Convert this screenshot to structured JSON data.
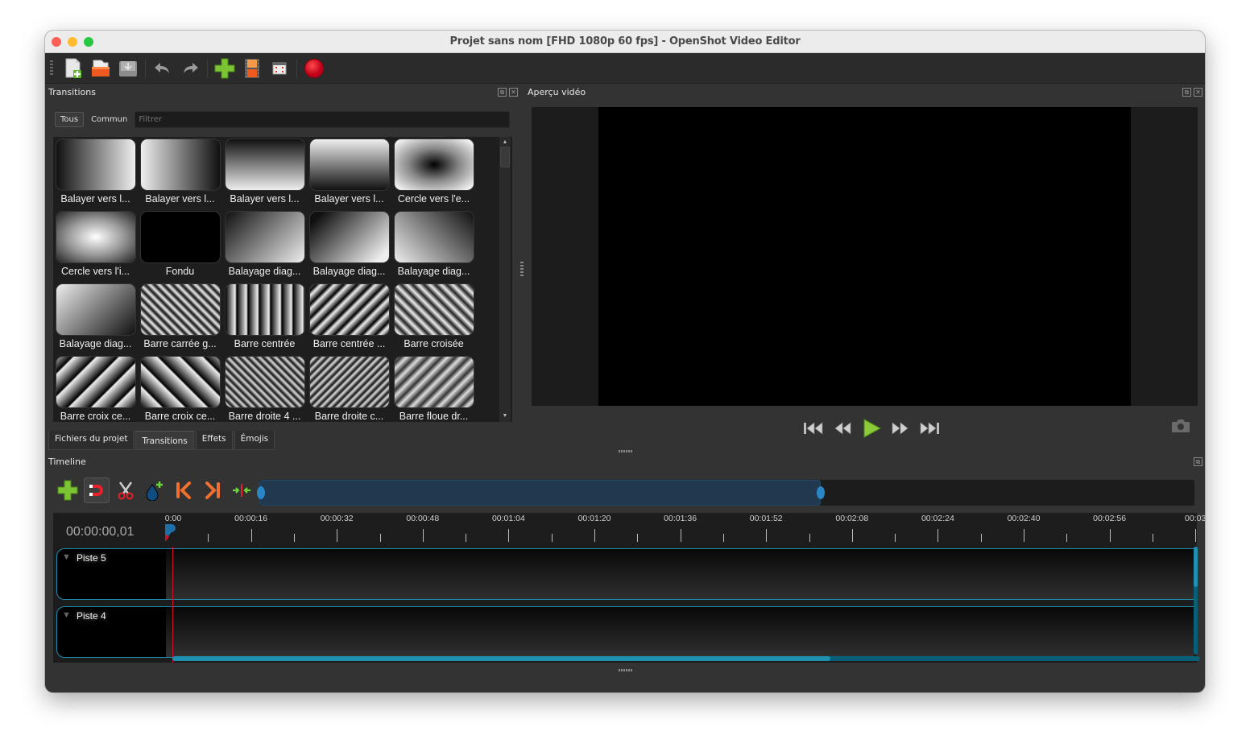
{
  "window": {
    "title": "Projet sans nom [FHD 1080p 60 fps] - OpenShot Video Editor"
  },
  "toolbar": {
    "items": [
      {
        "name": "new-project",
        "icon": "new-file-icon"
      },
      {
        "name": "open-project",
        "icon": "open-folder-icon"
      },
      {
        "name": "save-project",
        "icon": "save-icon"
      },
      {
        "name": "undo",
        "icon": "undo-icon"
      },
      {
        "name": "redo",
        "icon": "redo-icon"
      },
      {
        "name": "import-files",
        "icon": "plus-icon"
      },
      {
        "name": "choose-profile",
        "icon": "film-strip-icon"
      },
      {
        "name": "fullscreen",
        "icon": "fullscreen-icon"
      },
      {
        "name": "export-video",
        "icon": "record-icon"
      }
    ]
  },
  "transitions_panel": {
    "title": "Transitions",
    "filter_tabs": [
      "Tous",
      "Commun"
    ],
    "active_filter": "Tous",
    "filter_placeholder": "Filtrer",
    "filter_value": "",
    "items": [
      {
        "label": "Balayer vers l...",
        "thumb": "wipe-left"
      },
      {
        "label": "Balayer vers l...",
        "thumb": "wipe-right"
      },
      {
        "label": "Balayer vers l...",
        "thumb": "wipe-down"
      },
      {
        "label": "Balayer vers l...",
        "thumb": "wipe-up"
      },
      {
        "label": "Cercle vers l'e...",
        "thumb": "circle-out"
      },
      {
        "label": "Cercle vers l'i...",
        "thumb": "circle-in"
      },
      {
        "label": "Fondu",
        "thumb": "fade"
      },
      {
        "label": "Balayage diag...",
        "thumb": "diag-1"
      },
      {
        "label": "Balayage diag...",
        "thumb": "diag-2"
      },
      {
        "label": "Balayage diag...",
        "thumb": "diag-3"
      },
      {
        "label": "Balayage diag...",
        "thumb": "diag-4"
      },
      {
        "label": "Barre carrée g...",
        "thumb": "bars-square"
      },
      {
        "label": "Barre centrée",
        "thumb": "bars-vertical"
      },
      {
        "label": "Barre centrée ...",
        "thumb": "bars-centered"
      },
      {
        "label": "Barre croisée",
        "thumb": "bars-cross"
      },
      {
        "label": "Barre croix ce...",
        "thumb": "bars-diag-wide-a"
      },
      {
        "label": "Barre croix ce...",
        "thumb": "bars-diag-wide-b"
      },
      {
        "label": "Barre droite 4 ...",
        "thumb": "bars-right-4"
      },
      {
        "label": "Barre droite c...",
        "thumb": "bars-right-c"
      },
      {
        "label": "Barre floue dr...",
        "thumb": "bars-blur"
      }
    ]
  },
  "bottom_tabs": {
    "items": [
      "Fichiers du projet",
      "Transitions",
      "Effets",
      "Émojis"
    ],
    "active": "Transitions"
  },
  "preview_panel": {
    "title": "Aperçu vidéo",
    "controls": [
      {
        "name": "jump-start",
        "icon": "skip-start-icon"
      },
      {
        "name": "rewind",
        "icon": "rewind-icon"
      },
      {
        "name": "play",
        "icon": "play-icon"
      },
      {
        "name": "fast-forward",
        "icon": "fast-forward-icon"
      },
      {
        "name": "jump-end",
        "icon": "skip-end-icon"
      }
    ]
  },
  "timeline": {
    "title": "Timeline",
    "current_time": "00:00:00,01",
    "toolbar": [
      {
        "name": "add-track",
        "icon": "plus-icon"
      },
      {
        "name": "snapping",
        "icon": "magnet-icon",
        "active": true
      },
      {
        "name": "razor",
        "icon": "scissors-icon"
      },
      {
        "name": "add-marker",
        "icon": "marker-icon"
      },
      {
        "name": "previous-marker",
        "icon": "previous-marker-icon"
      },
      {
        "name": "next-marker",
        "icon": "next-marker-icon"
      },
      {
        "name": "center-playhead",
        "icon": "center-icon"
      }
    ],
    "zoom_range_fraction": [
      0.0,
      0.6
    ],
    "ruler_labels": [
      "0:00",
      "00:00:16",
      "00:00:32",
      "00:00:48",
      "00:01:04",
      "00:01:20",
      "00:01:36",
      "00:01:52",
      "00:02:08",
      "00:02:24",
      "00:02:40",
      "00:02:56",
      "00:03"
    ],
    "tracks": [
      {
        "name": "Piste 5"
      },
      {
        "name": "Piste 4"
      }
    ],
    "hscroll_fraction": 0.64,
    "vscroll_fraction": 0.37
  }
}
